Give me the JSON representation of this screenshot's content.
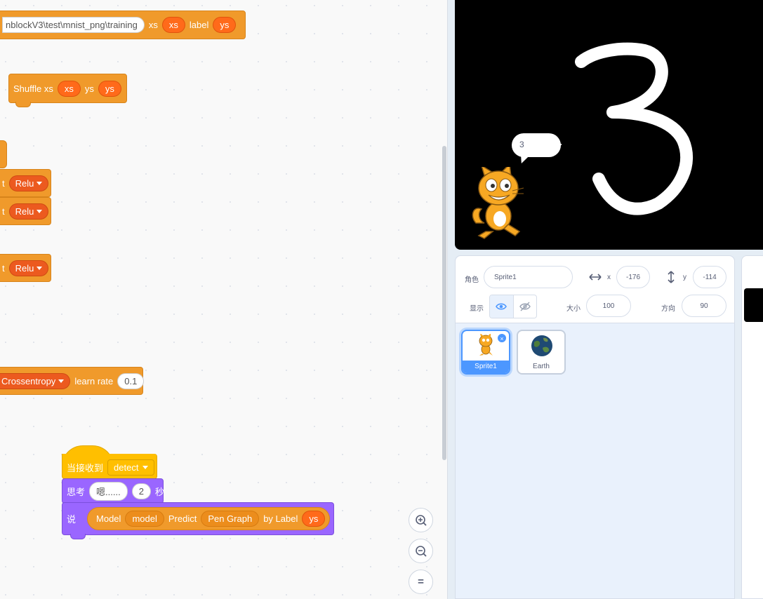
{
  "code": {
    "load_block": {
      "path": "nblockV3\\test\\mnist_png\\training",
      "xs_label": "xs",
      "xs_var": "xs",
      "label_label": "label",
      "label_var": "ys"
    },
    "shuffle_block": {
      "text": "Shuffle xs",
      "xs_var": "xs",
      "ys_label": "ys",
      "ys_var": "ys"
    },
    "layer_blocks": [
      {
        "prefix": "t",
        "activation": "Relu"
      },
      {
        "prefix": "t",
        "activation": "Relu"
      },
      {
        "prefix": "t",
        "activation": "Relu"
      }
    ],
    "compile_block": {
      "loss": "Crossentropy",
      "lr_label": "learn rate",
      "lr_value": "0.1"
    },
    "hat_block": {
      "label": "当接收到",
      "message": "detect"
    },
    "think_block": {
      "label": "思考",
      "text": "嗯......",
      "secs": "2",
      "unit": "秒"
    },
    "say_block": {
      "label": "说",
      "model_label": "Model",
      "model_var": "model",
      "predict_label": "Predict",
      "graph": "Pen Graph",
      "by_label": "by Label",
      "label_var": "ys"
    },
    "zoom": {
      "in": "+",
      "out": "−",
      "reset": "="
    }
  },
  "stage": {
    "bubble_text": "3"
  },
  "sprite_info": {
    "sprite_label": "角色",
    "sprite_name": "Sprite1",
    "x_label": "x",
    "x_value": "-176",
    "y_label": "y",
    "y_value": "-114",
    "show_label": "显示",
    "size_label": "大小",
    "size_value": "100",
    "direction_label": "方向",
    "direction_value": "90"
  },
  "sprites": [
    {
      "name": "Sprite1",
      "selected": true
    },
    {
      "name": "Earth",
      "selected": false
    }
  ],
  "colors": {
    "looks": "#9a66ff",
    "events": "#ffbf00",
    "extension": "#f09a2b",
    "accent": "#4c97ff"
  }
}
